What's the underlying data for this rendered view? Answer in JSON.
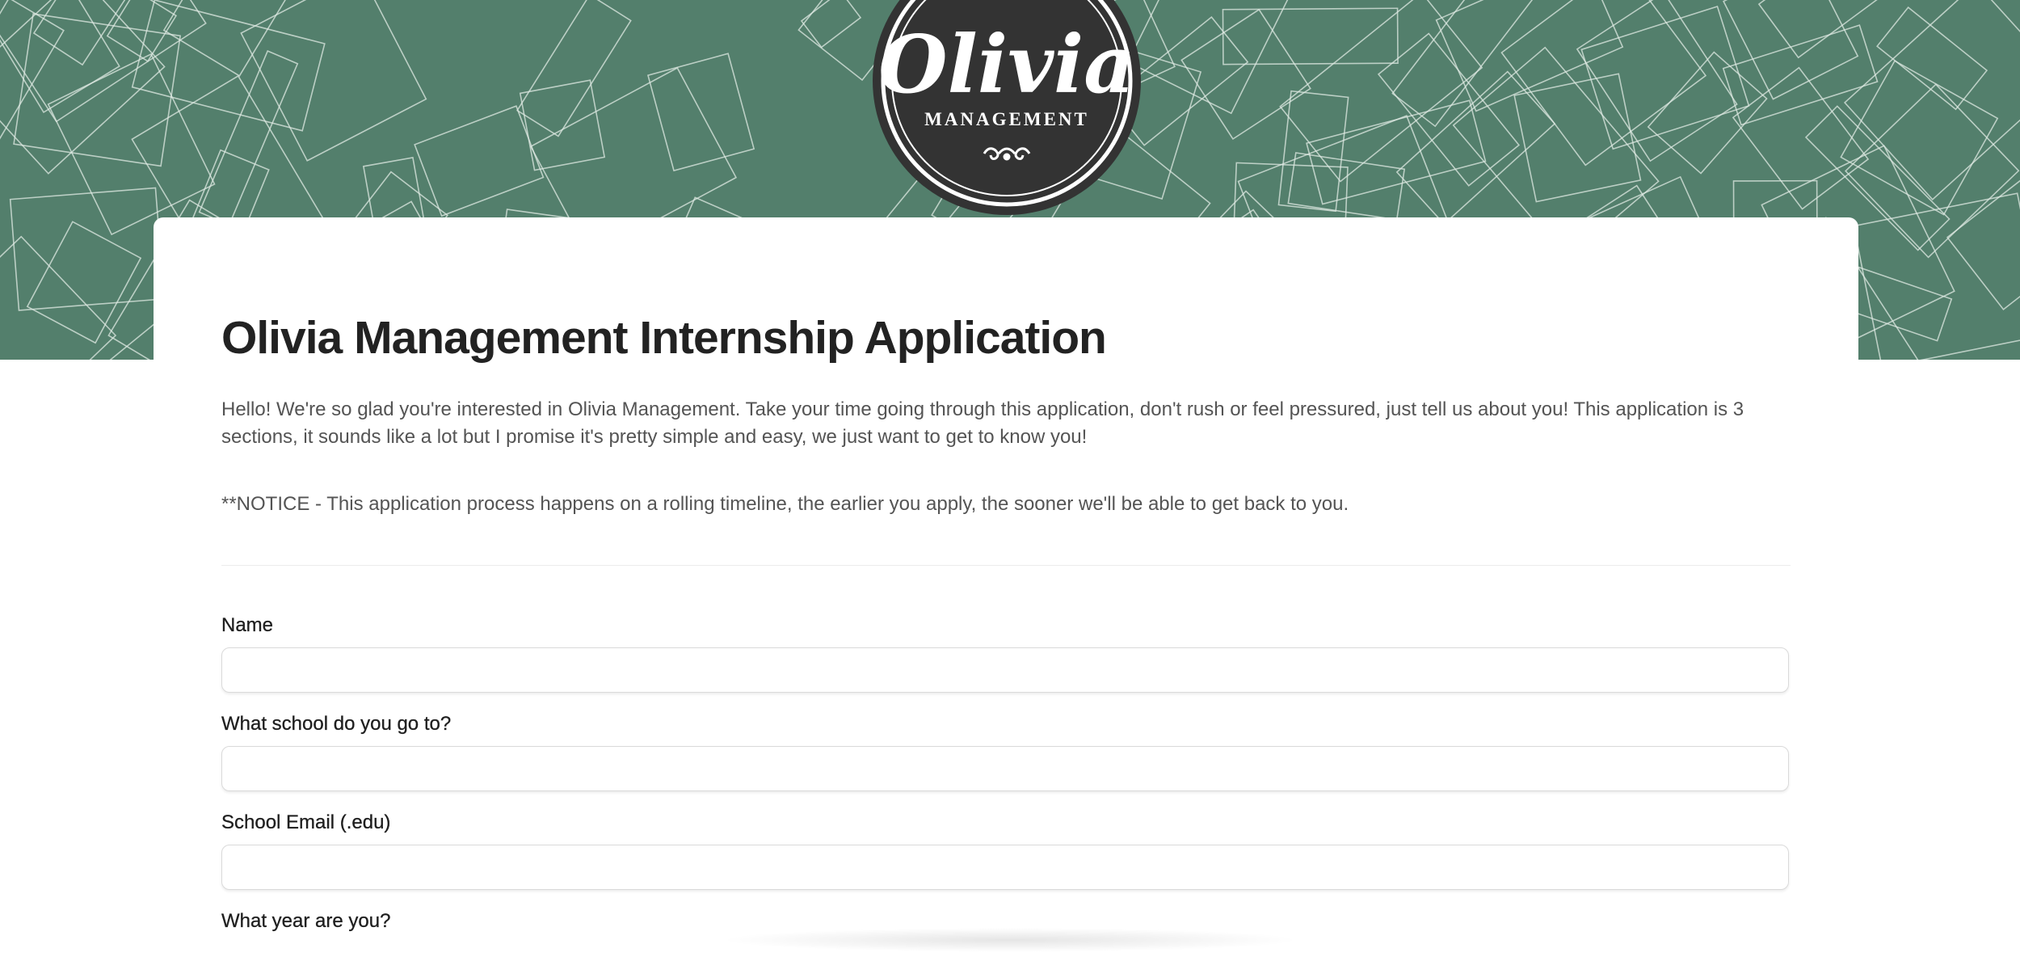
{
  "theme": {
    "banner_color": "#537f6c",
    "line_color": "#dfe9e3",
    "logo_color": "#333333"
  },
  "logo": {
    "name": "Olivia",
    "subtitle": "MANAGEMENT"
  },
  "form": {
    "title": "Olivia Management Internship Application",
    "intro": "Hello! We're so glad you're interested in Olivia Management. Take your time going through this application, don't rush or feel pressured, just tell us about you! This application is 3 sections, it sounds like a lot but I promise it's pretty simple and easy, we just want to get to know you!",
    "notice": "**NOTICE - This application process happens on a rolling timeline, the earlier you apply, the sooner we'll be able to get back to you.",
    "fields": [
      {
        "label": "Name",
        "value": ""
      },
      {
        "label": "What school do you go to?",
        "value": ""
      },
      {
        "label": "School Email (.edu)",
        "value": ""
      },
      {
        "label": "What year are you?"
      }
    ]
  }
}
